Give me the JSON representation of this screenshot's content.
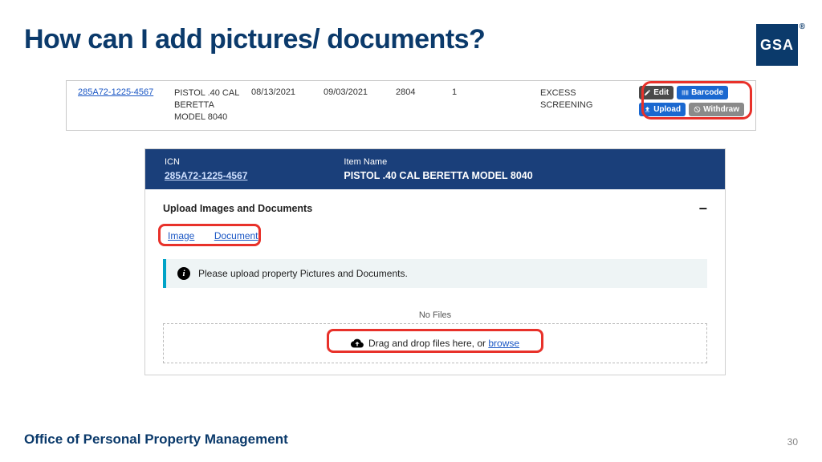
{
  "title": "How can I add pictures/ documents?",
  "logo": "GSA",
  "row": {
    "icn": "285A72-1225-4567",
    "desc": "PISTOL .40 CAL BERETTA MODEL 8040",
    "date1": "08/13/2021",
    "date2": "09/03/2021",
    "code": "2804",
    "qty": "1",
    "status": "EXCESS SCREENING",
    "btn_edit": "Edit",
    "btn_barcode": "Barcode",
    "btn_upload": "Upload",
    "btn_withdraw": "Withdraw"
  },
  "panel": {
    "icn_label": "ICN",
    "icn": "285A72-1225-4567",
    "name_label": "Item Name",
    "name": "PISTOL .40 CAL BERETTA MODEL 8040",
    "upload_header": "Upload Images and Documents",
    "tab_image": "Image",
    "tab_document": "Document",
    "info_msg": "Please upload property Pictures and Documents.",
    "nofiles": "No Files",
    "drop_prefix": "Drag and drop files here, or ",
    "drop_browse": "browse"
  },
  "footer": "Office of Personal Property Management",
  "page_num": "30"
}
